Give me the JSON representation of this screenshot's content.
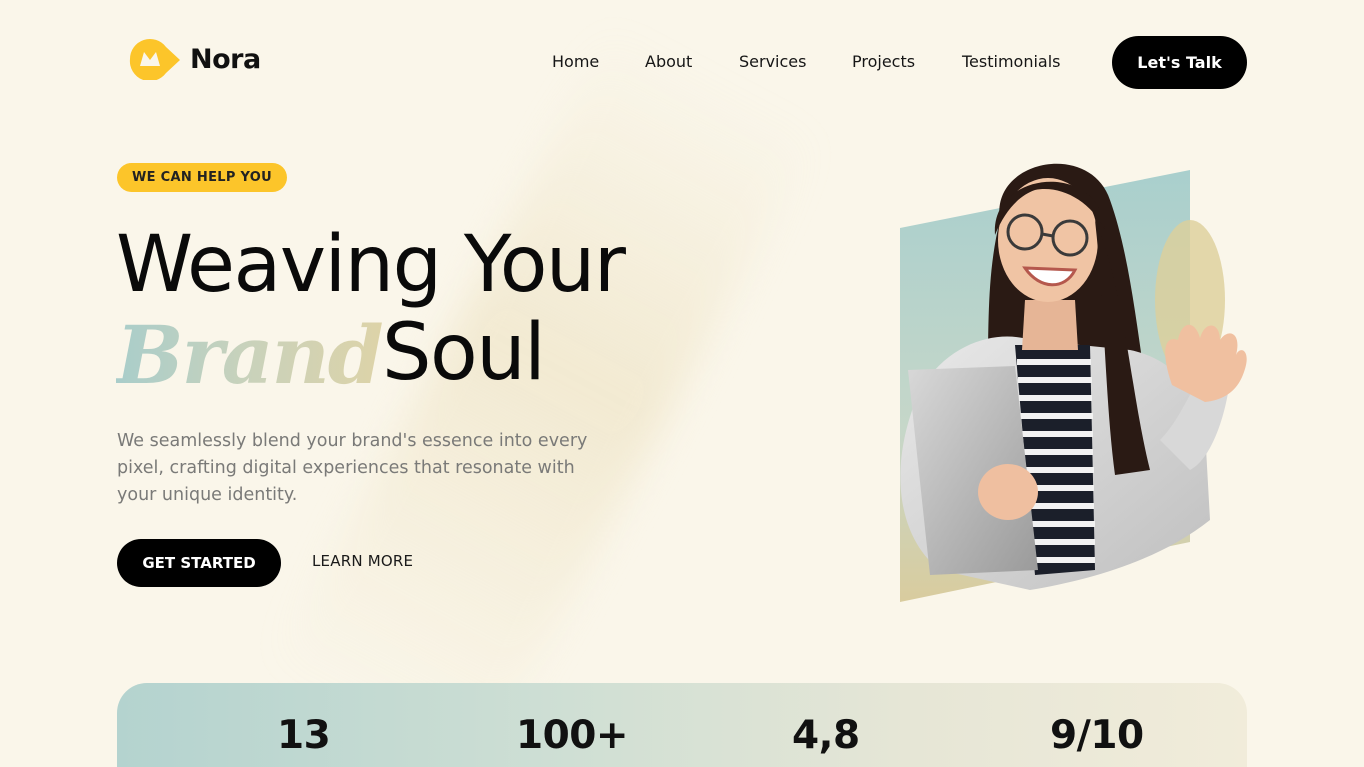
{
  "brand": {
    "name": "Nora",
    "accent": "#fcc52a"
  },
  "nav": {
    "items": [
      "Home",
      "About",
      "Services",
      "Projects",
      "Testimonials"
    ],
    "cta": "Let's Talk"
  },
  "hero": {
    "badge": "WE CAN HELP YOU",
    "title_line1": "Weaving Your",
    "title_brand": "Brand",
    "title_soul": "Soul",
    "description": "We seamlessly blend your brand's essence into every pixel, crafting digital experiences that resonate with your unique identity.",
    "primary_button": "GET STARTED",
    "secondary_button": "LEARN MORE",
    "image_icon": "smiling-woman-with-laptop-photo"
  },
  "stats": [
    "13",
    "100+",
    "4,8",
    "9/10"
  ],
  "colors": {
    "background": "#faf6ea",
    "dark": "#000000",
    "teal": "#b4d3cf",
    "sand": "#ddd3a8"
  }
}
